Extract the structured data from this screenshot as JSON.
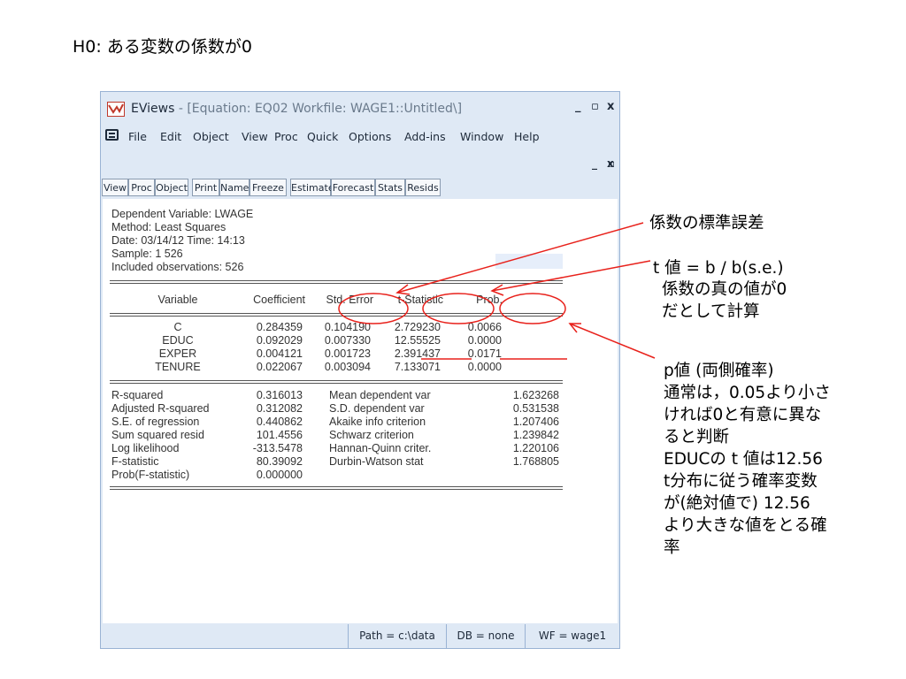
{
  "slide": {
    "title": "H0: ある変数の係数が0"
  },
  "window": {
    "app_name": "EViews",
    "title_rest": " - [Equation: EQ02   Workfile: WAGE1::Untitled\\]",
    "controls": {
      "minimize": "_",
      "maximize": "▫",
      "close": "x"
    }
  },
  "menu": [
    "File",
    "Edit",
    "Object",
    "View",
    "Proc",
    "Quick",
    "Options",
    "Add-ins",
    "Window",
    "Help"
  ],
  "toolbar": [
    "View",
    "Proc",
    "Object",
    "Print",
    "Name",
    "Freeze",
    "Estimate",
    "Forecast",
    "Stats",
    "Resids"
  ],
  "output": {
    "header": [
      "Dependent Variable: LWAGE",
      "Method: Least Squares",
      "Date: 03/14/12   Time: 14:13",
      "Sample: 1 526",
      "Included observations: 526"
    ],
    "columns": [
      "Variable",
      "Coefficient",
      "Std. Error",
      "t-Statistic",
      "Prob."
    ],
    "rows": [
      [
        "C",
        "0.284359",
        "0.104190",
        "2.729230",
        "0.0066"
      ],
      [
        "EDUC",
        "0.092029",
        "0.007330",
        "12.55525",
        "0.0000"
      ],
      [
        "EXPER",
        "0.004121",
        "0.001723",
        "2.391437",
        "0.0171"
      ],
      [
        "TENURE",
        "0.022067",
        "0.003094",
        "7.133071",
        "0.0000"
      ]
    ],
    "stats": [
      [
        "R-squared",
        "0.316013",
        "Mean dependent var",
        "1.623268"
      ],
      [
        "Adjusted R-squared",
        "0.312082",
        "S.D. dependent var",
        "0.531538"
      ],
      [
        "S.E. of regression",
        "0.440862",
        "Akaike info criterion",
        "1.207406"
      ],
      [
        "Sum squared resid",
        "101.4556",
        "Schwarz criterion",
        "1.239842"
      ],
      [
        "Log likelihood",
        "-313.5478",
        "Hannan-Quinn criter.",
        "1.220106"
      ],
      [
        "F-statistic",
        "80.39092",
        "Durbin-Watson stat",
        "1.768805"
      ],
      [
        "Prob(F-statistic)",
        "0.000000",
        "",
        ""
      ]
    ]
  },
  "status": [
    "Path = c:\\data",
    "DB = none",
    "WF = wage1"
  ],
  "annotations": {
    "std_error": "係数の標準誤差",
    "t_value": [
      " t 値 = b / b(s.e.)",
      "係数の真の値が0",
      "だとして計算"
    ],
    "p_value": [
      "p値 (両側確率)",
      "通常は，0.05より小さ",
      "ければ0と有意に異な",
      "ると判断",
      "EDUCの t 値は12.56",
      "t分布に従う確率変数",
      "が(絶対値で) 12.56",
      "より大きな値をとる確",
      "率"
    ]
  },
  "colors": {
    "annotation_red": "#e8211b",
    "window_frame": "#dfe9f5"
  }
}
